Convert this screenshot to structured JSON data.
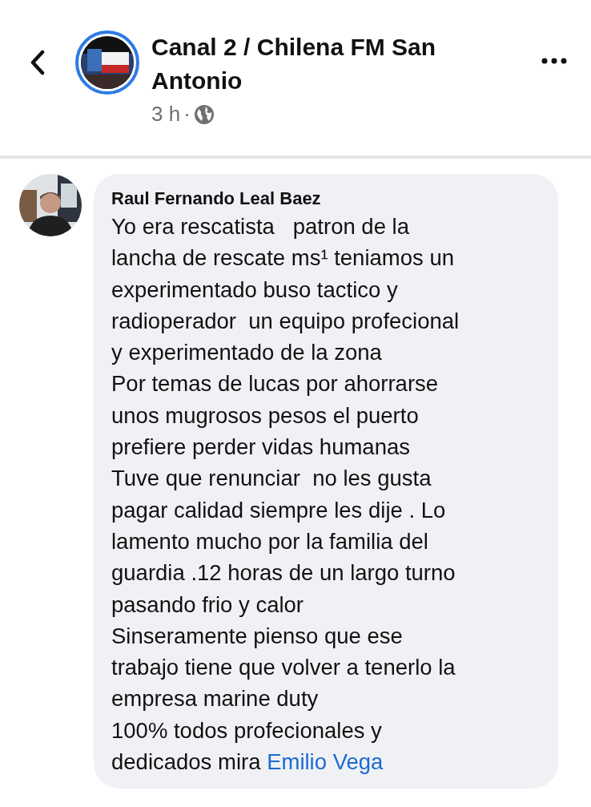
{
  "header": {
    "page_name": "Canal 2 / Chilena FM San Antonio",
    "time": "3 h",
    "separator": "·"
  },
  "comment": {
    "author": "Raul Fernando Leal Baez",
    "lines": [
      "Yo era rescatista   patron de la",
      "lancha de rescate ms¹ teniamos un",
      "experimentado buso tactico y",
      "radioperador  un equipo profecional",
      "y experimentado de la zona",
      "Por temas de lucas por ahorrarse",
      "unos mugrosos pesos el puerto",
      "prefiere perder vidas humanas",
      "Tuve que renunciar  no les gusta",
      "pagar calidad siempre les dije . Lo",
      "lamento mucho por la familia del",
      "guardia .12 horas de un largo turno",
      "pasando frio y calor",
      "Sinseramente pienso que ese",
      "trabajo tiene que volver a tenerlo la",
      "empresa marine duty",
      "100% todos profecionales y",
      "dedicados mira "
    ],
    "mention": "Emilio Vega"
  }
}
